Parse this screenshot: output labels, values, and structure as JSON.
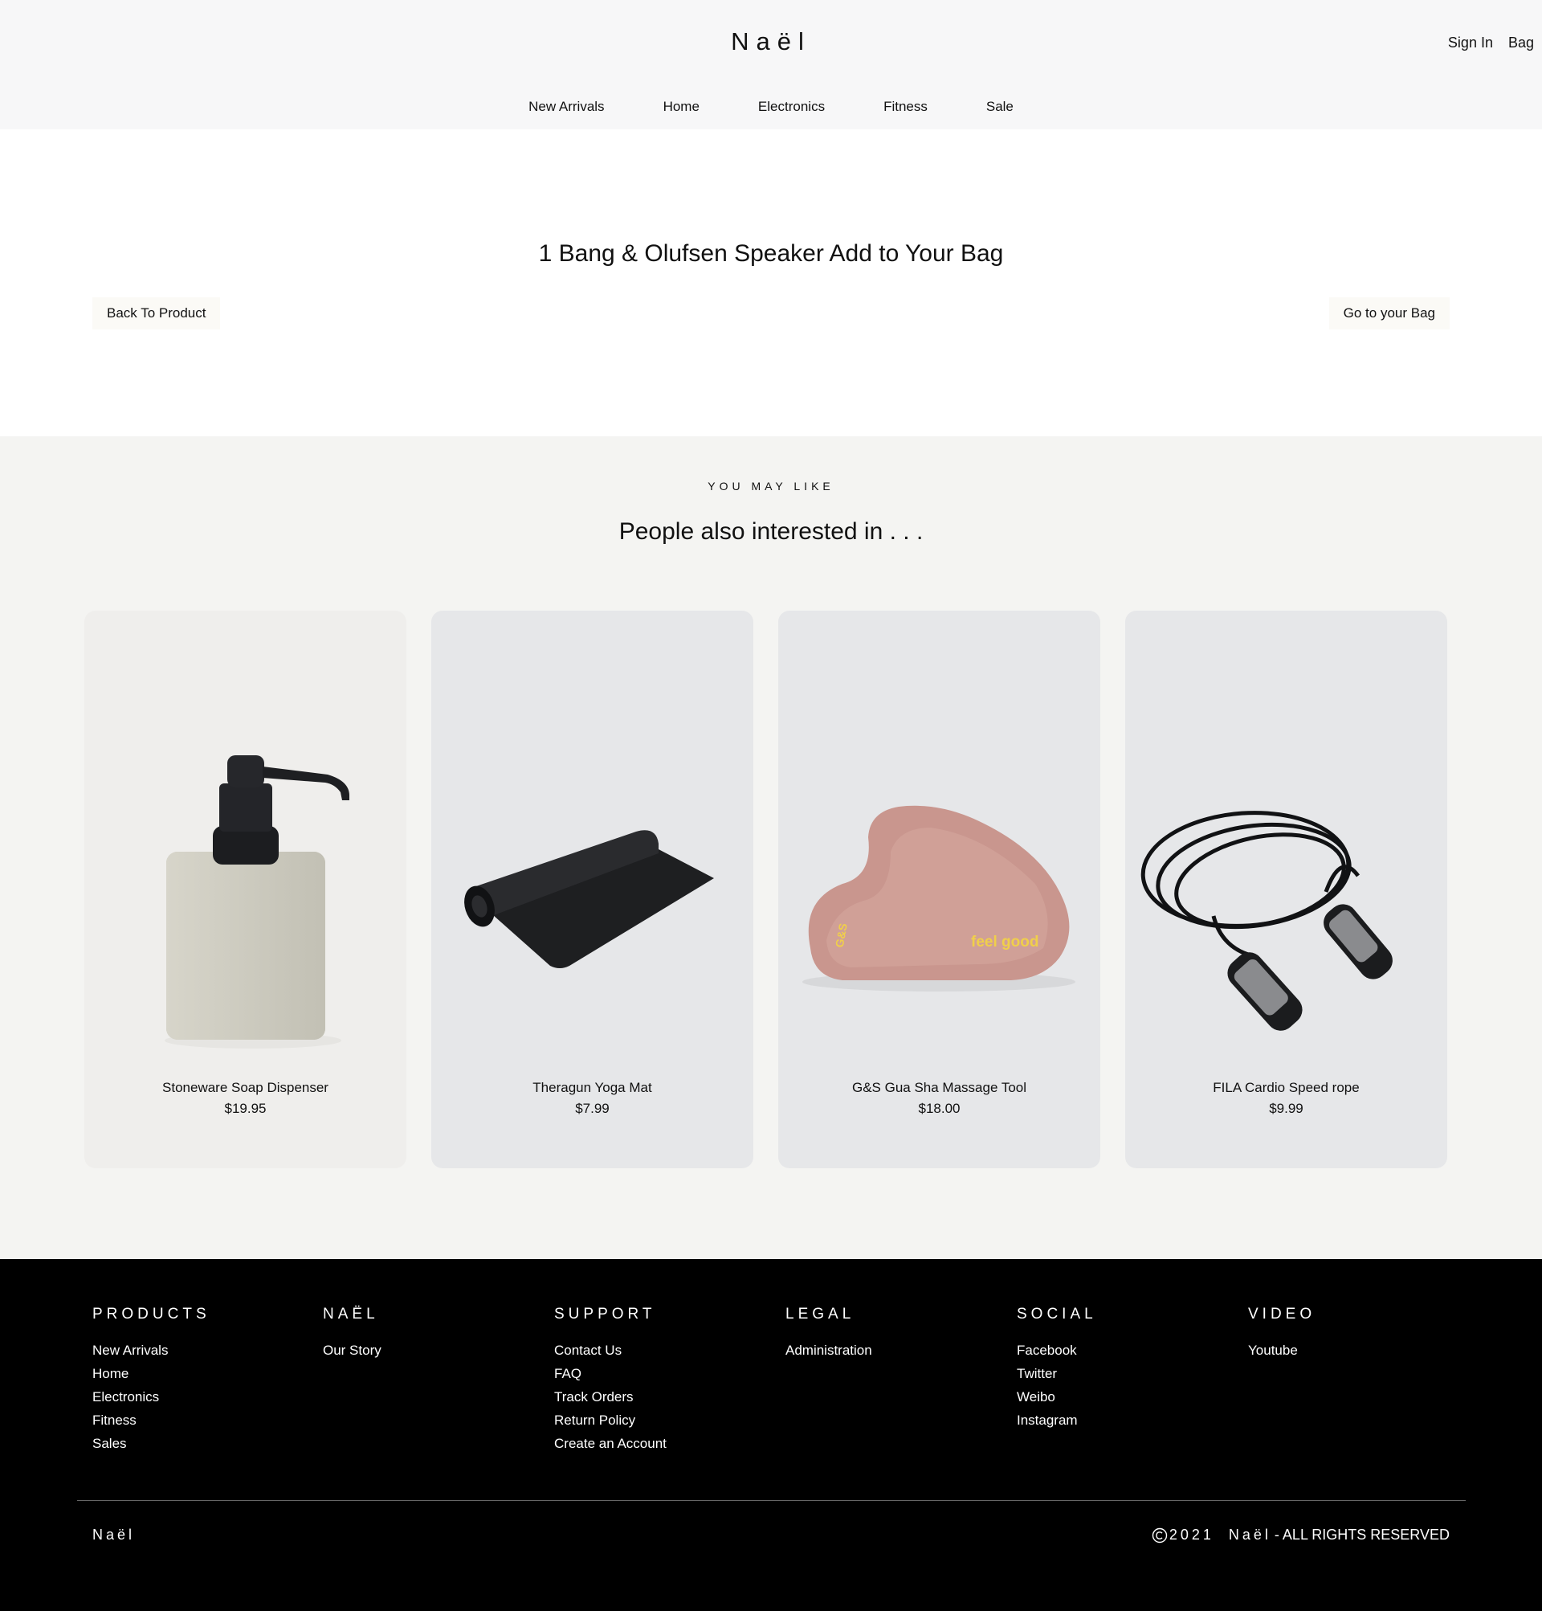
{
  "header": {
    "logo": "Naël",
    "sign_in": "Sign In",
    "bag": "Bag"
  },
  "nav": [
    "New Arrivals",
    "Home",
    "Electronics",
    "Fitness",
    "Sale"
  ],
  "added": {
    "title": "1 Bang & Olufsen Speaker Add to Your Bag",
    "back_button": "Back To Product",
    "bag_button": "Go to your Bag"
  },
  "recommendations": {
    "eyebrow": "YOU MAY LIKE",
    "title": "People also interested in . . .",
    "products": [
      {
        "name": "Stoneware Soap Dispenser",
        "price": "$19.95"
      },
      {
        "name": "Theragun Yoga Mat",
        "price": "$7.99"
      },
      {
        "name": "G&S Gua Sha Massage Tool",
        "price": "$18.00"
      },
      {
        "name": "FILA Cardio Speed rope",
        "price": "$9.99"
      }
    ]
  },
  "footer": {
    "columns": [
      {
        "heading": "PRODUCTS",
        "links": [
          "New Arrivals",
          "Home",
          "Electronics",
          "Fitness",
          "Sales"
        ]
      },
      {
        "heading": "NAËL",
        "links": [
          "Our Story"
        ]
      },
      {
        "heading": "SUPPORT",
        "links": [
          "Contact Us",
          "FAQ",
          "Track Orders",
          "Return Policy",
          "Create an Account"
        ]
      },
      {
        "heading": "LEGAL",
        "links": [
          "Administration"
        ]
      },
      {
        "heading": "SOCIAL",
        "links": [
          "Facebook",
          "Twitter",
          "Weibo",
          "Instagram"
        ]
      },
      {
        "heading": "VIDEO",
        "links": [
          "Youtube"
        ]
      }
    ],
    "brand": "Naël",
    "copyright_year": "2021",
    "copyright_brand": "Naël",
    "copyright_text": "- ALL RIGHTS RESERVED"
  }
}
